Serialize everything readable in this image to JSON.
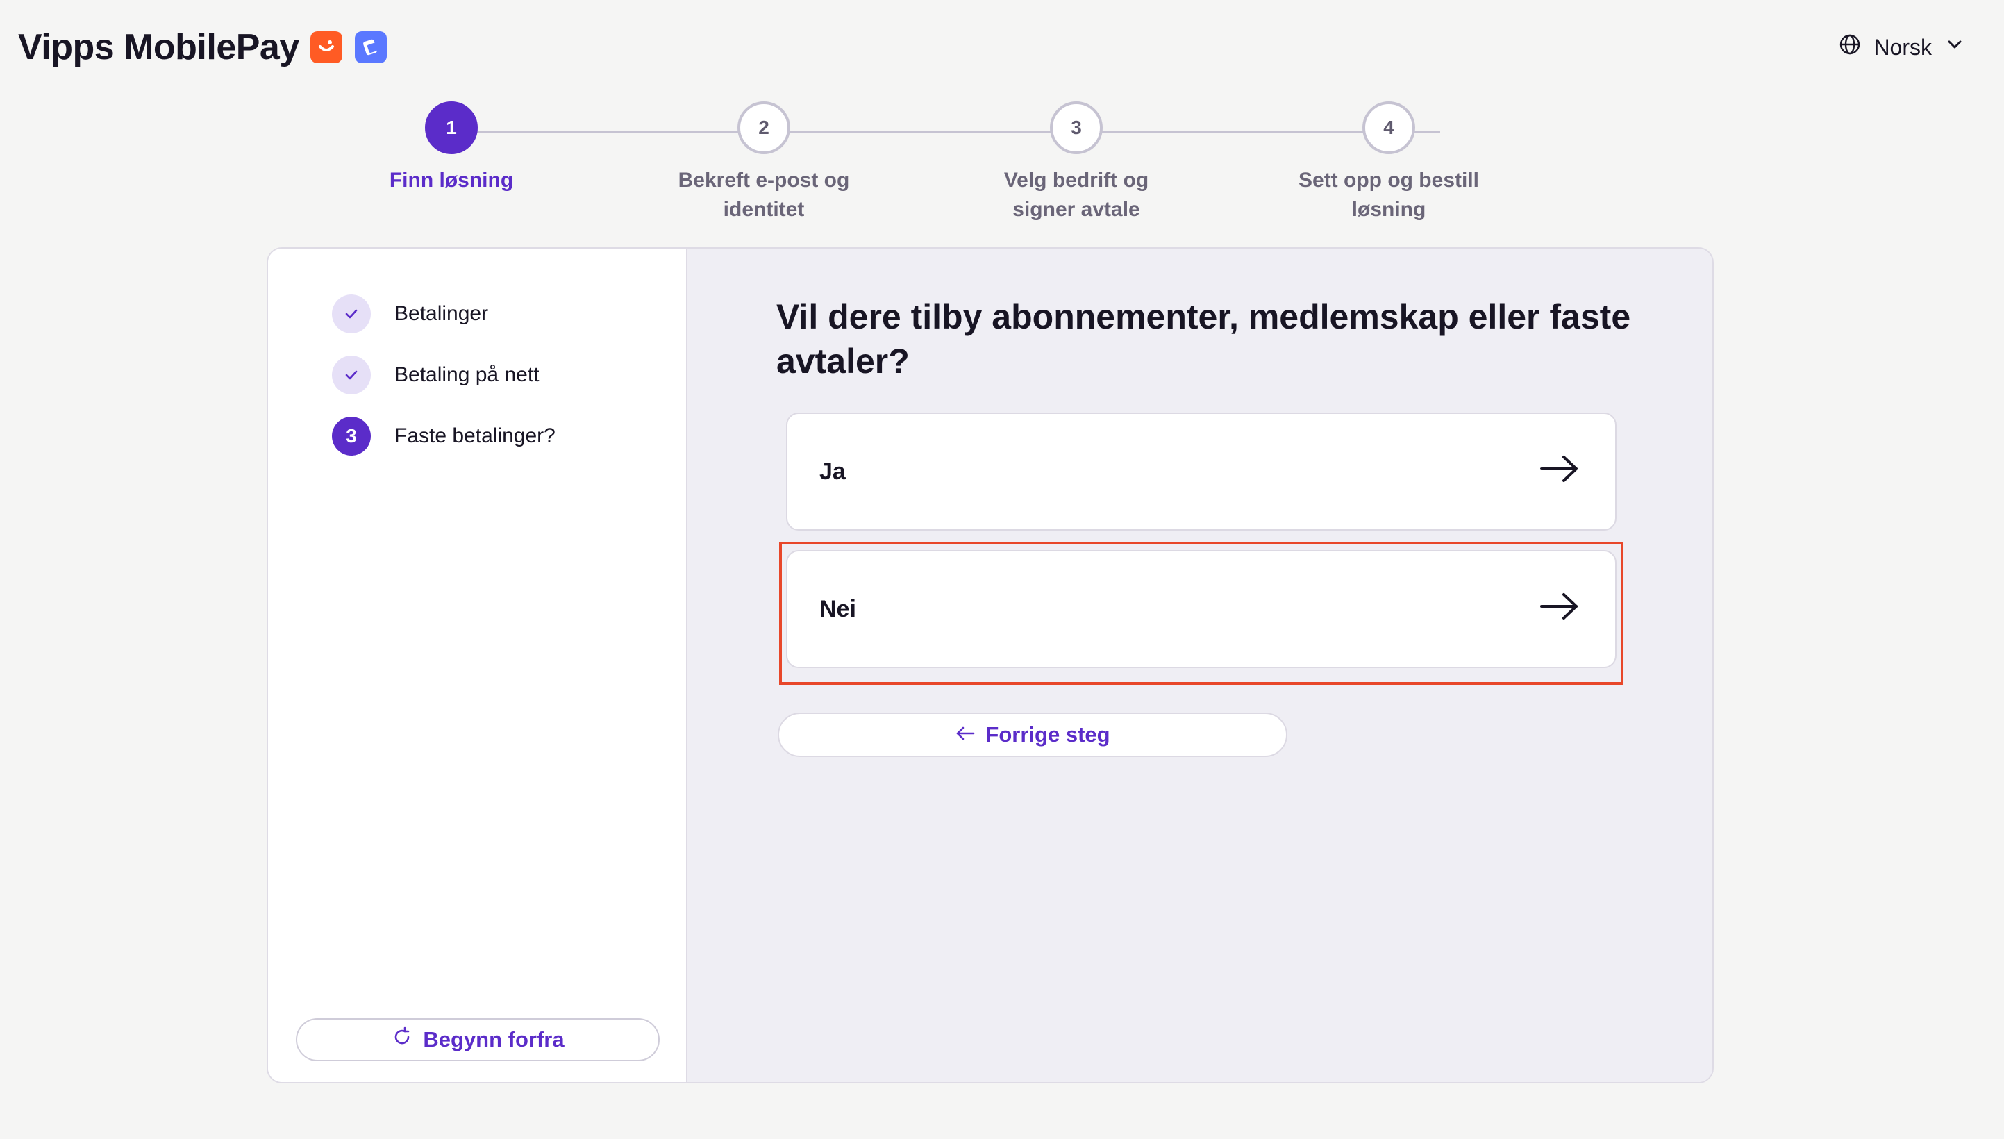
{
  "brand": {
    "name": "Vipps MobilePay"
  },
  "language": {
    "label": "Norsk"
  },
  "stepper": {
    "steps": [
      {
        "number": "1",
        "label": "Finn løsning",
        "state": "active"
      },
      {
        "number": "2",
        "label_line1": "Bekreft e-post og",
        "label_line2": "identitet",
        "state": "upcoming"
      },
      {
        "number": "3",
        "label_line1": "Velg bedrift og",
        "label_line2": "signer avtale",
        "state": "upcoming"
      },
      {
        "number": "4",
        "label_line1": "Sett opp og bestill",
        "label_line2": "løsning",
        "state": "upcoming"
      }
    ]
  },
  "sidebar": {
    "items": [
      {
        "label": "Betalinger",
        "status": "done"
      },
      {
        "label": "Betaling på nett",
        "status": "done"
      },
      {
        "label": "Faste betalinger?",
        "status": "current",
        "number": "3"
      }
    ],
    "restart_label": "Begynn forfra"
  },
  "main": {
    "question": "Vil dere tilby abonnementer, medlemskap eller faste avtaler?",
    "options": [
      {
        "label": "Ja"
      },
      {
        "label": "Nei"
      }
    ],
    "back_label": "Forrige steg"
  },
  "colors": {
    "accent": "#5b2cc9",
    "brand_orange": "#ff5b24",
    "brand_blue": "#5a78ff",
    "highlight": "#e8472a"
  }
}
